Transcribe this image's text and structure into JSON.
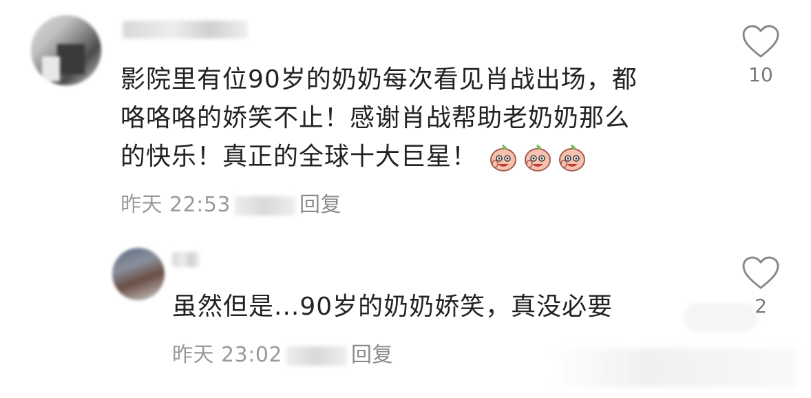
{
  "comments": {
    "main": {
      "lines": [
        "影院里有位90岁的奶奶每次看见肖战出场，都",
        "咯咯咯的娇笑不止！感谢肖战帮助老奶奶那么",
        "的快乐！真正的全球十大巨星！"
      ],
      "emoji": [
        "peach-laugh-emoji",
        "peach-laugh-emoji",
        "peach-laugh-emoji"
      ],
      "time": "昨天 22:53",
      "reply_label": "回复",
      "likes": "10"
    },
    "reply": {
      "text": "虽然但是...90岁的奶奶娇笑，真没必要",
      "time": "昨天 23:02",
      "reply_label": "回复",
      "likes": "2"
    }
  },
  "icons": {
    "like": "heart-outline-icon"
  },
  "colors": {
    "text": "#222222",
    "meta": "#9a9a9a",
    "icon": "#888888"
  }
}
